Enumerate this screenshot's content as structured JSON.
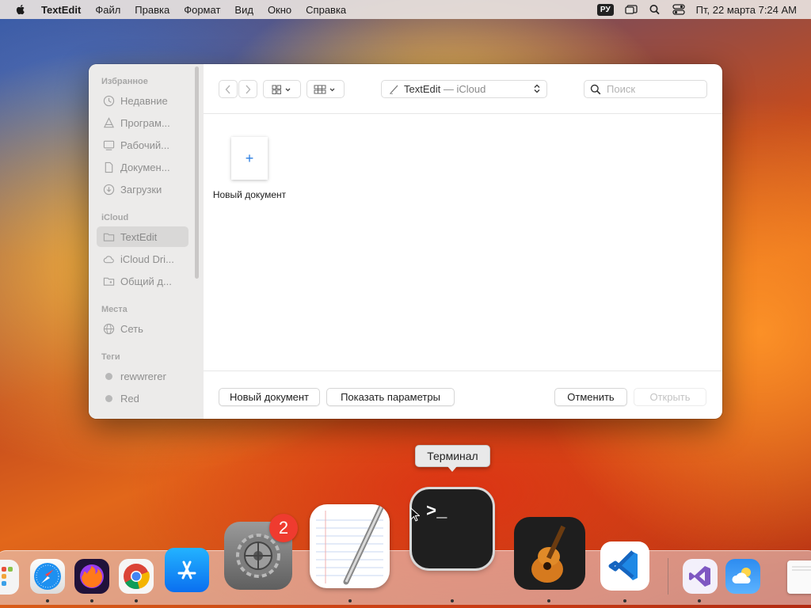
{
  "menubar": {
    "app_name": "TextEdit",
    "items": [
      "Файл",
      "Правка",
      "Формат",
      "Вид",
      "Окно",
      "Справка"
    ],
    "input_source": "РУ",
    "clock": "Пт, 22 марта  7:24 AM"
  },
  "sidebar": {
    "favorites_title": "Избранное",
    "favorites": [
      "Недавние",
      "Програм...",
      "Рабочий...",
      "Докумен...",
      "Загрузки"
    ],
    "icloud_title": "iCloud",
    "icloud": [
      "TextEdit",
      "iCloud Dri...",
      "Общий д..."
    ],
    "places_title": "Места",
    "places": [
      "Сеть"
    ],
    "tags_title": "Теги",
    "tags": [
      "rewwrerer",
      "Red"
    ]
  },
  "toolbar": {
    "path_app": "TextEdit",
    "path_sep": " — ",
    "path_loc": "iCloud",
    "search_placeholder": "Поиск"
  },
  "content": {
    "new_doc_plus": "+",
    "new_doc_label": "Новый документ"
  },
  "footer": {
    "new_document": "Новый документ",
    "show_options": "Показать параметры",
    "cancel": "Отменить",
    "open": "Открыть"
  },
  "dock": {
    "tooltip": "Терминал",
    "settings_badge": "2",
    "icons": [
      "launchpad-icon",
      "safari-icon",
      "firefox-icon",
      "chrome-icon",
      "app-store-icon",
      "system-settings-icon",
      "textedit-icon",
      "terminal-icon",
      "garageband-icon",
      "vscode-icon",
      "visual-studio-icon",
      "weather-icon",
      "document-preview-icon"
    ]
  }
}
